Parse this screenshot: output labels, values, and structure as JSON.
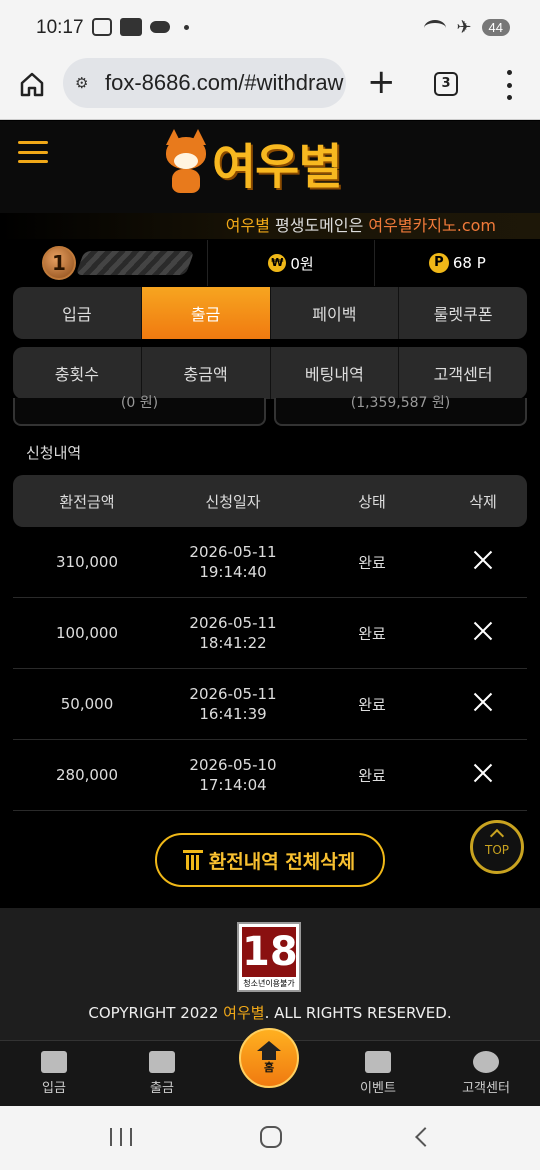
{
  "status_bar": {
    "time": "10:17",
    "battery": "44"
  },
  "browser": {
    "url": "fox-8686.com/#withdraw",
    "tab_count": "3"
  },
  "site": {
    "logo_text": "여우별",
    "domain_notice": {
      "brand": "여우별",
      "middle": " 평생도메인은 ",
      "domain": "여우별카지노.com"
    }
  },
  "user": {
    "level": "1",
    "money": "0원",
    "points": "68 P"
  },
  "tabs_row1": [
    {
      "label": "입금",
      "active": false
    },
    {
      "label": "출금",
      "active": true
    },
    {
      "label": "페이백",
      "active": false
    },
    {
      "label": "룰렛쿠폰",
      "active": false
    }
  ],
  "tabs_row2": [
    {
      "label": "충횟수"
    },
    {
      "label": "충금액"
    },
    {
      "label": "베팅내역"
    },
    {
      "label": "고객센터"
    }
  ],
  "partial_boxes": [
    "(0 원)",
    "(1,359,587 원)"
  ],
  "section_title": "신청내역",
  "table": {
    "headers": [
      "환전금액",
      "신청일자",
      "상태",
      "삭제"
    ],
    "rows": [
      {
        "amount": "310,000",
        "date": "2026-05-11",
        "time": "19:14:40",
        "status": "완료"
      },
      {
        "amount": "100,000",
        "date": "2026-05-11",
        "time": "18:41:22",
        "status": "완료"
      },
      {
        "amount": "50,000",
        "date": "2026-05-11",
        "time": "16:41:39",
        "status": "완료"
      },
      {
        "amount": "280,000",
        "date": "2026-05-10",
        "time": "17:14:04",
        "status": "완료"
      }
    ]
  },
  "delete_all_label": "환전내역 전체삭제",
  "top_button_label": "TOP",
  "footer": {
    "age_badge_number": "18",
    "age_badge_label": "청소년이용불가",
    "copyright_prefix": "COPYRIGHT 2022 ",
    "copyright_brand": "여우별",
    "copyright_suffix": ". ALL RIGHTS RESERVED."
  },
  "bottom_nav": {
    "deposit": "입금",
    "withdraw": "출금",
    "home": "홈",
    "event": "이벤트",
    "support": "고객센터"
  },
  "colors": {
    "accent": "#f0a818",
    "active_tab": "#f7a520",
    "background": "#000000"
  }
}
